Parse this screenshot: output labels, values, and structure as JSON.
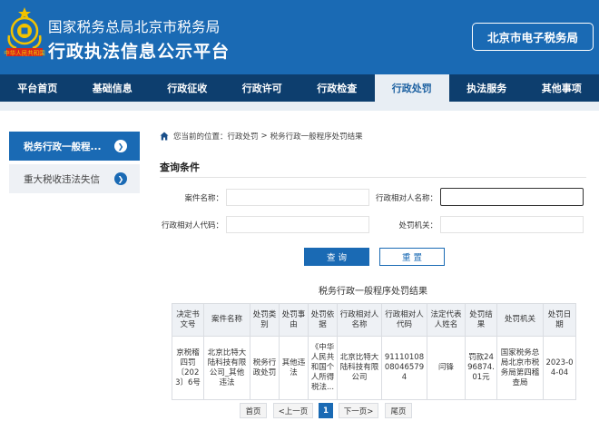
{
  "header": {
    "seal_text": "中华人民共和国",
    "org_name": "国家税务总局北京市税务局",
    "platform_name": "行政执法信息公示平台",
    "etax_label": "北京市电子税务局"
  },
  "nav": {
    "items": [
      "平台首页",
      "基础信息",
      "行政征收",
      "行政许可",
      "行政检查",
      "行政处罚",
      "执法服务",
      "其他事项"
    ],
    "active_index": 5
  },
  "sidebar": {
    "items": [
      {
        "label": "税务行政一般程...",
        "active": true
      },
      {
        "label": "重大税收违法失信",
        "active": false
      }
    ]
  },
  "breadcrumb": {
    "prefix": "您当前的位置：",
    "level1": "行政处罚",
    "separator": ">",
    "level2": "税务行政一般程序处罚结果"
  },
  "query": {
    "title": "查询条件",
    "case_name_label": "案件名称：",
    "case_name_value": "",
    "counterparty_name_label": "行政相对人名称：",
    "counterparty_name_value": "",
    "counterparty_code_label": "行政相对人代码：",
    "counterparty_code_value": "",
    "authority_label": "处罚机关：",
    "authority_value": "",
    "query_button": "查 询",
    "reset_button": "重 置"
  },
  "results": {
    "title": "税务行政一般程序处罚结果",
    "columns": [
      "决定书文号",
      "案件名称",
      "处罚类别",
      "处罚事由",
      "处罚依据",
      "行政相对人名称",
      "行政相对人代码",
      "法定代表人姓名",
      "处罚结果",
      "处罚机关",
      "处罚日期"
    ],
    "rows": [
      [
        "京税稽四罚〔2023〕6号",
        "北京比特大陆科技有限公司_其他违法",
        "税务行政处罚",
        "其他违法",
        "《中华人民共和国个人所得税法...",
        "北京比特大陆科技有限公司",
        "91110108080465794",
        "闫锋",
        "罚款2496874.01元",
        "国家税务总局北京市税务局第四稽查局",
        "2023-04-04"
      ]
    ]
  },
  "pagination": {
    "first": "首页",
    "prev": "<上一页",
    "current": "1",
    "next": "下一页>",
    "last": "尾页"
  }
}
